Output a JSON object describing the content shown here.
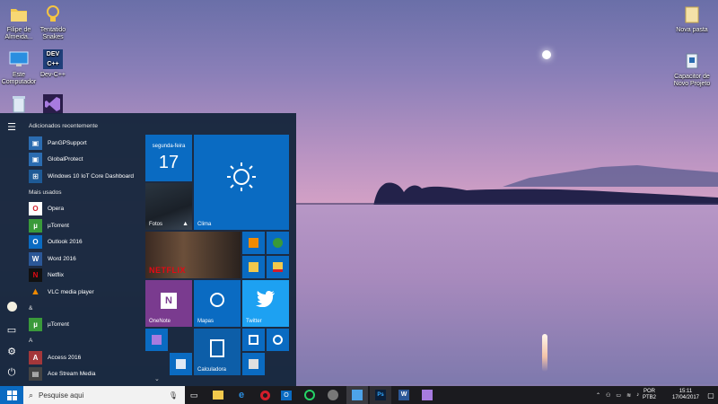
{
  "desktop": {
    "icons_left": [
      {
        "name": "folder-icon",
        "label": "Filipe de\nAlmeida..."
      },
      {
        "name": "bulb-icon",
        "label": "Tentatido\nSnakes"
      },
      {
        "name": "computer-icon",
        "label": "Este\nComputador"
      },
      {
        "name": "devcpp-icon",
        "label": "Dev-C++"
      },
      {
        "name": "recycle-bin-icon",
        "label": ""
      },
      {
        "name": "visual-studio-icon",
        "label": ""
      }
    ],
    "icons_right": [
      {
        "name": "folder-icon",
        "label": "Nova pasta"
      },
      {
        "name": "project-icon",
        "label": "Capacitor de\nNovo Projeto"
      }
    ]
  },
  "start_menu": {
    "recent_header": "Adicionados recentemente",
    "recent": [
      {
        "label": "PanGPSupport",
        "icon": "app-icon",
        "color": "#2b6cb0"
      },
      {
        "label": "GlobalProtect",
        "icon": "app-icon",
        "color": "#2b6cb0"
      },
      {
        "label": "Windows 10 IoT Core Dashboard",
        "icon": "iot-icon",
        "color": "#1e5a96"
      }
    ],
    "most_used_header": "Mais usados",
    "most_used": [
      {
        "label": "Opera",
        "icon": "opera-icon",
        "color": "#d21e2b"
      },
      {
        "label": "µTorrent",
        "icon": "utorrent-icon",
        "color": "#3a9a3a"
      },
      {
        "label": "Outlook 2016",
        "icon": "outlook-icon",
        "color": "#0a6bc2"
      },
      {
        "label": "Word 2016",
        "icon": "word-icon",
        "color": "#2b5797"
      },
      {
        "label": "Netflix",
        "icon": "netflix-icon",
        "color": "#111111"
      },
      {
        "label": "VLC media player",
        "icon": "vlc-icon",
        "color": "#e67e00"
      }
    ],
    "amp_header": "&",
    "amp": [
      {
        "label": "µTorrent",
        "icon": "utorrent-icon",
        "color": "#3a9a3a"
      }
    ],
    "a_header": "A",
    "a_list": [
      {
        "label": "Access 2016",
        "icon": "access-icon",
        "color": "#a4373a"
      },
      {
        "label": "Ace Stream Media",
        "icon": "acestream-icon",
        "color": "#444444"
      }
    ],
    "tiles": {
      "calendar_day": "segunda-feira",
      "calendar_date": "17",
      "weather": "Clima",
      "photos": "Fotos",
      "onenote": "OneNote",
      "maps": "Mapas",
      "twitter": "Twitter",
      "calculator": "Calculadora",
      "netflix_brand": "NETFLIX"
    }
  },
  "taskbar": {
    "search_placeholder": "Pesquise aqui",
    "lang_top": "POR",
    "lang_bottom": "PTB2",
    "time": "15:11",
    "date": "17/04/2017"
  }
}
